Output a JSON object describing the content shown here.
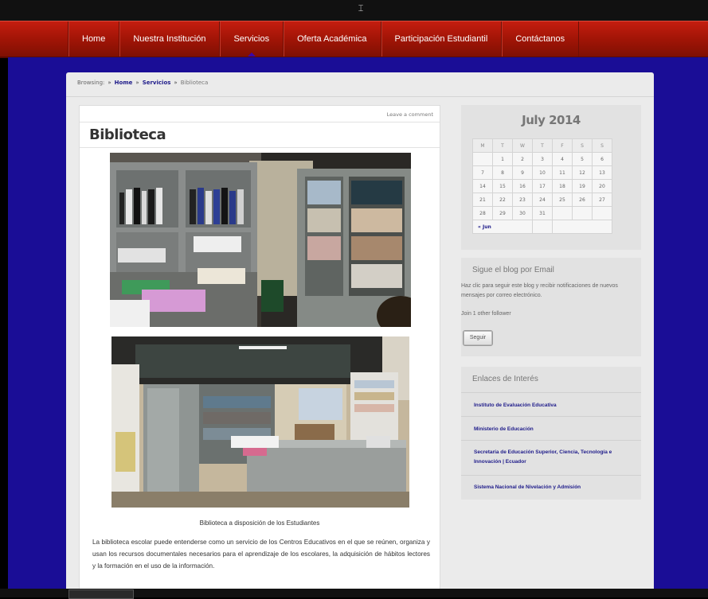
{
  "nav": {
    "items": [
      {
        "label": "Home"
      },
      {
        "label": "Nuestra Institución"
      },
      {
        "label": "Servicios"
      },
      {
        "label": "Oferta Académica"
      },
      {
        "label": "Participación Estudiantil"
      },
      {
        "label": "Contáctanos"
      }
    ]
  },
  "breadcrumb": {
    "prefix": "Browsing:",
    "sep": "»",
    "home": "Home",
    "section": "Servicios",
    "current": "Biblioteca"
  },
  "post": {
    "leave_comment": "Leave a comment",
    "title": "Biblioteca",
    "caption": "Biblioteca a disposición de los Estudiantes",
    "paragraph": "La biblioteca escolar puede entenderse como un servicio de los Centros Educativos en el que se reúnen, organiza y usan los recursos documentales necesarios para el aprendizaje de los escolares, la adquisición de hábitos lectores y la formación en el uso de la información."
  },
  "calendar": {
    "title": "July 2014",
    "weekdays": [
      "M",
      "T",
      "W",
      "T",
      "F",
      "S",
      "S"
    ],
    "weeks": [
      [
        "",
        "1",
        "2",
        "3",
        "4",
        "5",
        "6"
      ],
      [
        "7",
        "8",
        "9",
        "10",
        "11",
        "12",
        "13"
      ],
      [
        "14",
        "15",
        "16",
        "17",
        "18",
        "19",
        "20"
      ],
      [
        "21",
        "22",
        "23",
        "24",
        "25",
        "26",
        "27"
      ],
      [
        "28",
        "29",
        "30",
        "31",
        "",
        "",
        ""
      ]
    ],
    "prev": "« Jun"
  },
  "follow": {
    "heading": "Sigue el blog por Email",
    "text": "Haz clic para seguir este blog y recibir notificaciones de nuevos mensajes por correo electrónico.",
    "followers": "Join 1 other follower",
    "button": "Seguir"
  },
  "links": {
    "heading": "Enlaces de Interés",
    "items": [
      {
        "label": "Instituto de Evaluación Educativa"
      },
      {
        "label": "Ministerio de Educación"
      },
      {
        "label": "Secretaría de Educación Superior, Ciencia, Tecnología e Innovación | Ecuador"
      },
      {
        "label": "Sistema Nacional de Nivelación y Admisión"
      }
    ]
  },
  "colors": {
    "nav_red": "#9e1406",
    "page_blue": "#1a0d96",
    "link_blue": "#1e1b8a"
  }
}
